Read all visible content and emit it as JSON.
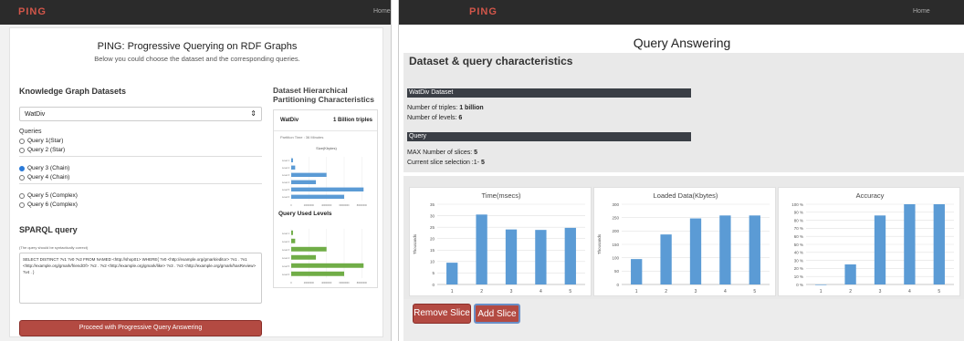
{
  "left": {
    "brand": "PING",
    "nav_home": "Home",
    "title": "PING: Progressive Querying on RDF Graphs",
    "subtitle": "Below you could choose the dataset and the corresponding queries.",
    "kg_heading": "Knowledge Graph Datasets",
    "dataset_select": "WatDiv",
    "queries_label": "Queries",
    "queries": [
      {
        "label": "Query 1(Star)",
        "checked": false
      },
      {
        "label": "Query 2 (Star)",
        "checked": false
      },
      {
        "label": "Query 3 (Chain)",
        "checked": true
      },
      {
        "label": "Query 4 (Chain)",
        "checked": false
      },
      {
        "label": "Query 5 (Complex)",
        "checked": false
      },
      {
        "label": "Query 6 (Complex)",
        "checked": false
      }
    ],
    "sparql_heading": "SPARQL query",
    "sparql_hint": "(The query should be syntactically correct)",
    "sparql_text": "SELECT DISTINCT ?v1 ?v0 ?v2 FROM NAMED <http://shop01> WHERE{ ?v0 <http://example.org/gmark/editor> ?v1 . ?v1 <http://example.org/gmark/friendOf> ?v2 . ?v2 <http://example.org/gmark/like> ?v3 . ?v3 <http://example.org/gmark/hasReview> ?v4 . }",
    "proceed_button": "Proceed with Progressive Query Answering",
    "hier_heading": "Dataset Hierarchical Partitioning Characteristics",
    "watdiv_label": "WatDiv",
    "triples_label": "1 Billion triples",
    "partition_time": "Partition Time : 36 Minutes",
    "size_chart_title": "Size(Kbytes)",
    "query_levels_heading": "Query Used Levels",
    "mini_levels": [
      "Level 1",
      "Level 2",
      "Level 3",
      "Level 4",
      "Level 5",
      "Level 6"
    ],
    "mini_ticks": [
      "0",
      "20000000",
      "40000000",
      "60000000",
      "80000000"
    ]
  },
  "right": {
    "brand": "PING",
    "nav_home": "Home",
    "title": "Query Answering",
    "section_heading": "Dataset & query characteristics",
    "dataset_bar": "WatDiv Dataset",
    "triples_prefix": "Number of triples:",
    "triples_value": "1 billion",
    "levels_prefix": "Number of levels:",
    "levels_value": "6",
    "query_bar": "Query",
    "slices_prefix": "MAX Number of slices:",
    "slices_value": "5",
    "selection_prefix": "Current slice selection :1-",
    "selection_value": "5",
    "remove_button": "Remove Slice",
    "add_button": "Add Slice"
  },
  "colors": {
    "accent": "#b34a42",
    "bar_blue": "#5b9bd5",
    "bar_green": "#70ad47",
    "dark": "#2b2b2b"
  },
  "chart_data": [
    {
      "type": "bar",
      "title": "Time(msecs)",
      "ylabel": "Thousands",
      "categories": [
        "1",
        "2",
        "3",
        "4",
        "5"
      ],
      "values": [
        9.5,
        30.5,
        24,
        23.8,
        24.7
      ],
      "ylim": [
        0,
        35
      ],
      "yticks": [
        "0",
        "5",
        "10",
        "15",
        "20",
        "25",
        "30",
        "35"
      ]
    },
    {
      "type": "bar",
      "title": "Loaded Data(Kbytes)",
      "ylabel": "Thousands",
      "categories": [
        "1",
        "2",
        "3",
        "4",
        "5"
      ],
      "values": [
        95,
        187,
        247,
        258,
        258
      ],
      "ylim": [
        0,
        300
      ],
      "yticks": [
        "0",
        "50",
        "100",
        "150",
        "200",
        "250",
        "300"
      ]
    },
    {
      "type": "bar",
      "title": "Accuracy",
      "categories": [
        "1",
        "2",
        "3",
        "4",
        "5"
      ],
      "values": [
        0,
        25,
        86,
        100,
        100
      ],
      "ylim": [
        0,
        100
      ],
      "yticks": [
        "0 %",
        "10 %",
        "20 %",
        "30 %",
        "40 %",
        "50 %",
        "60 %",
        "70 %",
        "80 %",
        "90 %",
        "100 %"
      ]
    },
    {
      "type": "bar",
      "title": "Size(Kbytes)",
      "orientation": "horizontal",
      "categories": [
        "Level 1",
        "Level 2",
        "Level 3",
        "Level 4",
        "Level 5",
        "Level 6"
      ],
      "values": [
        2000000,
        4500000,
        40000000,
        28000000,
        82000000,
        60000000
      ],
      "xlim": [
        0,
        90000000
      ]
    },
    {
      "type": "bar",
      "orientation": "horizontal",
      "categories": [
        "Level 1",
        "Level 2",
        "Level 3",
        "Level 4",
        "Level 5",
        "Level 6"
      ],
      "values": [
        2000000,
        4500000,
        40000000,
        28000000,
        82000000,
        60000000
      ],
      "xlim": [
        0,
        90000000
      ]
    }
  ]
}
